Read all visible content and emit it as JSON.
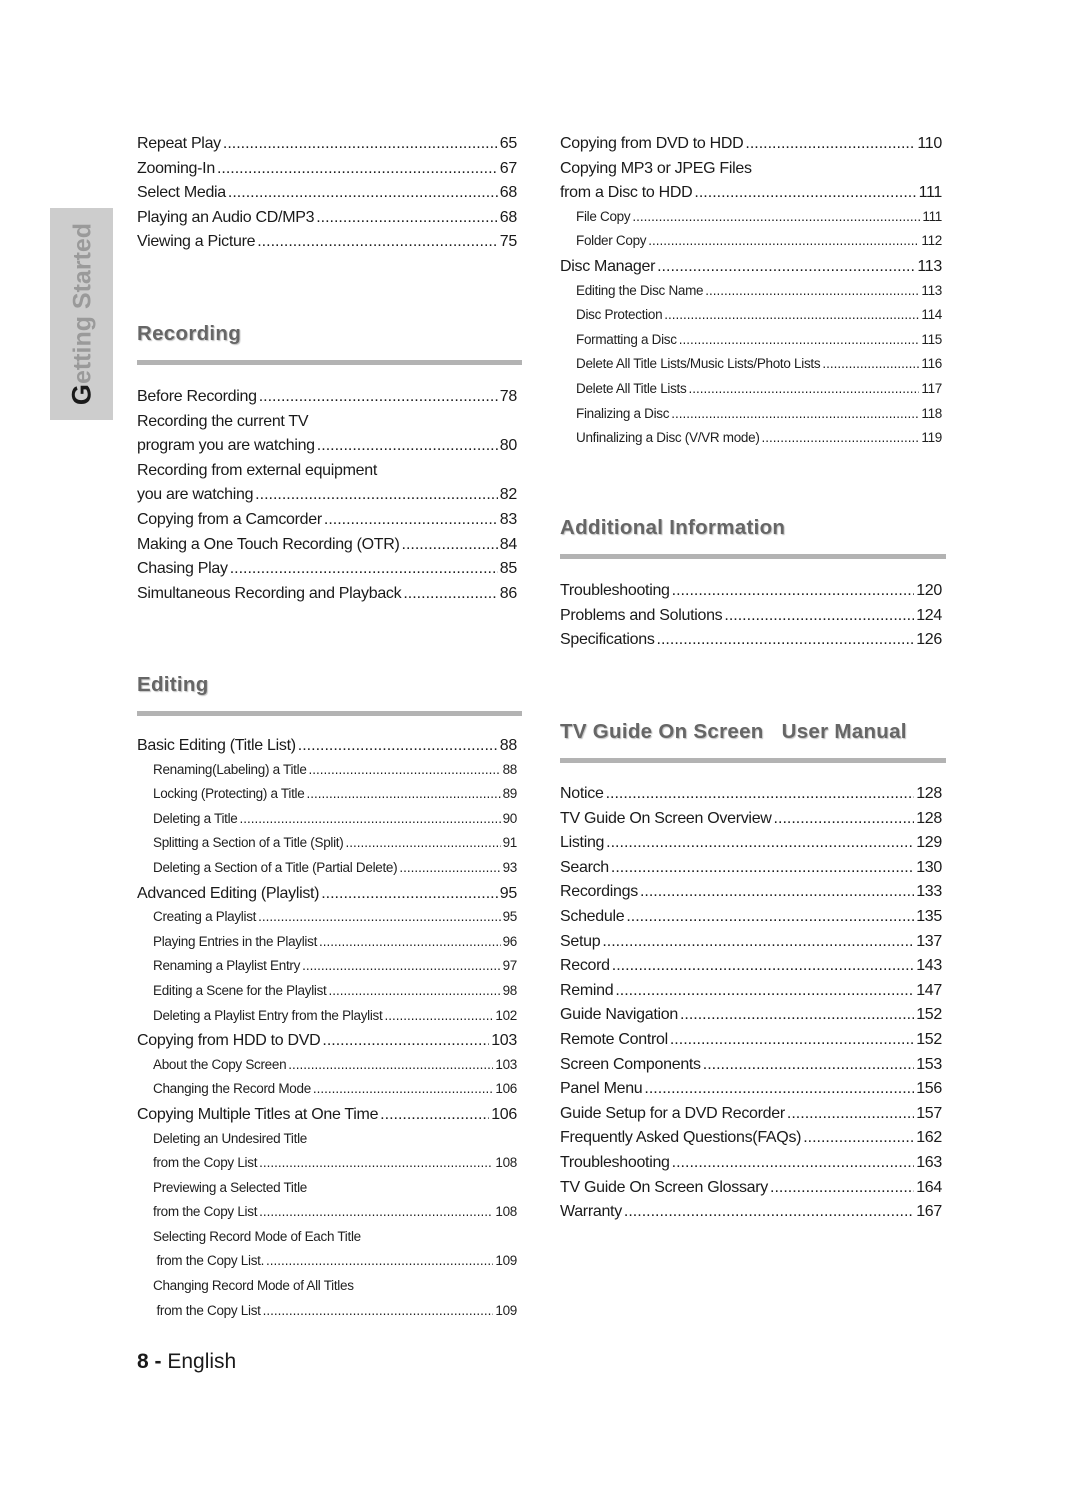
{
  "side_tab": {
    "first_letter": "G",
    "rest": "etting Started"
  },
  "left_top": [
    {
      "label": "Repeat Play",
      "page": "65"
    },
    {
      "label": "Zooming-In",
      "page": "67"
    },
    {
      "label": "Select Media",
      "page": "68"
    },
    {
      "label": "Playing an Audio CD/MP3",
      "page": "68"
    },
    {
      "label": "Viewing a Picture",
      "page": "75"
    }
  ],
  "recording": {
    "title": "Recording",
    "entries": [
      {
        "label": "Before Recording",
        "page": "78"
      },
      {
        "label": "Recording the current TV",
        "page": ""
      },
      {
        "label": "program you are watching",
        "page": "80"
      },
      {
        "label": "Recording from external equipment",
        "page": ""
      },
      {
        "label": "you are watching",
        "page": "82"
      },
      {
        "label": "Copying from a Camcorder",
        "page": "83"
      },
      {
        "label": "Making a One Touch Recording (OTR)",
        "page": "84"
      },
      {
        "label": "Chasing Play",
        "page": "85"
      },
      {
        "label": "Simultaneous Recording and Playback",
        "page": "86"
      }
    ]
  },
  "editing": {
    "title": "Editing",
    "entries": [
      {
        "label": "Basic Editing (Title List)",
        "page": "88",
        "sub": false
      },
      {
        "label": "Renaming(Labeling) a Title",
        "page": "88",
        "sub": true
      },
      {
        "label": "Locking (Protecting) a Title",
        "page": "89",
        "sub": true
      },
      {
        "label": "Deleting a Title",
        "page": "90",
        "sub": true
      },
      {
        "label": "Splitting a Section of a Title (Split)",
        "page": "91",
        "sub": true
      },
      {
        "label": "Deleting a Section of a Title (Partial Delete)",
        "page": "93",
        "sub": true
      },
      {
        "label": "Advanced Editing (Playlist)",
        "page": "95",
        "sub": false
      },
      {
        "label": "Creating a Playlist",
        "page": "95",
        "sub": true
      },
      {
        "label": "Playing Entries in the Playlist",
        "page": "96",
        "sub": true
      },
      {
        "label": "Renaming a Playlist Entry",
        "page": "97",
        "sub": true
      },
      {
        "label": "Editing a Scene for the Playlist",
        "page": "98",
        "sub": true
      },
      {
        "label": "Deleting a Playlist Entry from the Playlist",
        "page": "102",
        "sub": true
      },
      {
        "label": "Copying from HDD to DVD",
        "page": "103",
        "sub": false
      },
      {
        "label": "About the Copy Screen",
        "page": "103",
        "sub": true
      },
      {
        "label": "Changing the Record Mode",
        "page": "106",
        "sub": true
      },
      {
        "label": "Copying Multiple Titles at One Time",
        "page": "106",
        "sub": false
      },
      {
        "label": "Deleting an Undesired Title",
        "page": "",
        "sub": true
      },
      {
        "label": "from the Copy List",
        "page": "108",
        "sub": true
      },
      {
        "label": "Previewing a Selected Title",
        "page": "",
        "sub": true
      },
      {
        "label": "from the Copy List",
        "page": "108",
        "sub": true
      },
      {
        "label": "Selecting Record Mode of Each Title",
        "page": "",
        "sub": true
      },
      {
        "label": " from the Copy List.",
        "page": "109",
        "sub": true
      },
      {
        "label": "Changing Record Mode of All Titles",
        "page": "",
        "sub": true
      },
      {
        "label": " from the Copy List",
        "page": "109",
        "sub": true
      }
    ]
  },
  "right_top": [
    {
      "label": "Copying from DVD to HDD",
      "page": "110",
      "sub": false
    },
    {
      "label": "Copying MP3 or JPEG Files",
      "page": "",
      "sub": false
    },
    {
      "label": "from a Disc to HDD",
      "page": "111",
      "sub": false
    },
    {
      "label": "File Copy",
      "page": "111",
      "sub": true
    },
    {
      "label": "Folder Copy",
      "page": "112",
      "sub": true
    },
    {
      "label": "Disc Manager",
      "page": "113",
      "sub": false
    },
    {
      "label": "Editing the Disc Name",
      "page": "113",
      "sub": true
    },
    {
      "label": "Disc Protection",
      "page": "114",
      "sub": true
    },
    {
      "label": "Formatting a Disc",
      "page": "115",
      "sub": true
    },
    {
      "label": "Delete All Title Lists/Music Lists/Photo Lists",
      "page": "116",
      "sub": true
    },
    {
      "label": "Delete All Title Lists",
      "page": "117",
      "sub": true
    },
    {
      "label": "Finalizing a Disc",
      "page": "118",
      "sub": true
    },
    {
      "label": "Unfinalizing a Disc (V/VR mode)",
      "page": "119",
      "sub": true
    }
  ],
  "additional": {
    "title": "Additional Information",
    "entries": [
      {
        "label": "Troubleshooting",
        "page": "120"
      },
      {
        "label": "Problems and Solutions",
        "page": "124"
      },
      {
        "label": "Specifications",
        "page": "126"
      }
    ]
  },
  "tvguide": {
    "title": "TV Guide On Screen   User Manual",
    "entries": [
      {
        "label": "Notice",
        "page": "128"
      },
      {
        "label": "TV Guide On Screen Overview",
        "page": "128"
      },
      {
        "label": "Listing",
        "page": "129"
      },
      {
        "label": "Search",
        "page": "130"
      },
      {
        "label": "Recordings",
        "page": "133"
      },
      {
        "label": "Schedule",
        "page": "135"
      },
      {
        "label": "Setup",
        "page": "137"
      },
      {
        "label": "Record",
        "page": "143"
      },
      {
        "label": "Remind",
        "page": "147"
      },
      {
        "label": "Guide Navigation",
        "page": "152"
      },
      {
        "label": "Remote Control",
        "page": "152"
      },
      {
        "label": "Screen Components",
        "page": "153"
      },
      {
        "label": "Panel Menu",
        "page": "156"
      },
      {
        "label": "Guide Setup for a DVD Recorder",
        "page": "157"
      },
      {
        "label": "Frequently Asked Questions(FAQs)",
        "page": "162"
      },
      {
        "label": "Troubleshooting",
        "page": "163"
      },
      {
        "label": "TV Guide On Screen Glossary",
        "page": "164"
      },
      {
        "label": "Warranty",
        "page": "167"
      }
    ]
  },
  "footer": {
    "page_number": "8 -",
    "language": "English"
  }
}
